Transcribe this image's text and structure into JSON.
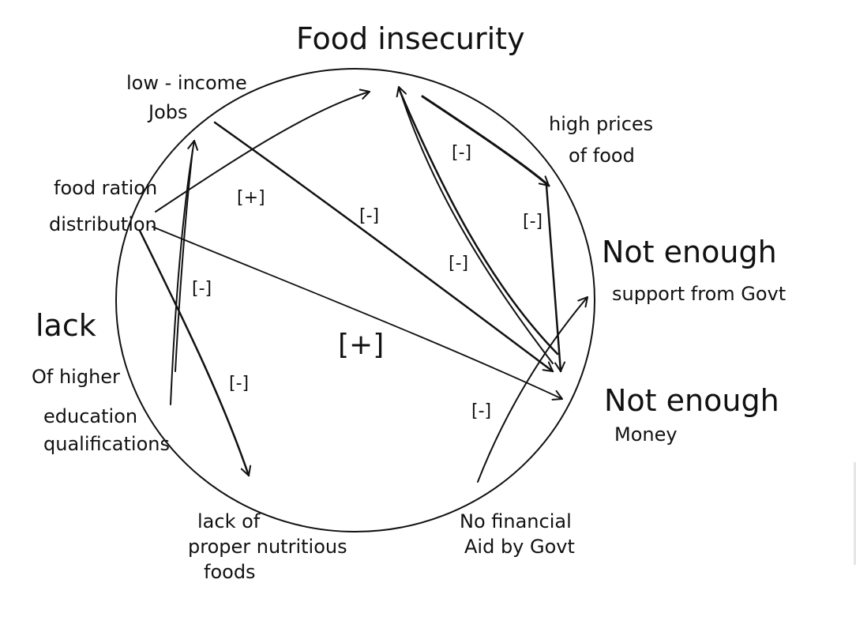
{
  "diagram": {
    "nodes": [
      {
        "id": "food_insecurity",
        "lines": [
          "Food insecurity"
        ]
      },
      {
        "id": "low_income_jobs",
        "lines": [
          "low - income",
          "Jobs"
        ]
      },
      {
        "id": "high_prices",
        "lines": [
          "high prices",
          "of food"
        ]
      },
      {
        "id": "food_ration",
        "lines": [
          "food ration",
          "distribution"
        ]
      },
      {
        "id": "not_enough_support",
        "lines": [
          "Not enough",
          "support from Govt"
        ]
      },
      {
        "id": "lack_education",
        "lines": [
          "lack",
          "Of higher",
          "education",
          "qualifications"
        ]
      },
      {
        "id": "not_enough_money",
        "lines": [
          "Not enough",
          "Money"
        ]
      },
      {
        "id": "lack_nutritious",
        "lines": [
          "lack of",
          "proper nutritious",
          "foods"
        ]
      },
      {
        "id": "no_financial_aid",
        "lines": [
          "No financial",
          "Aid by Govt"
        ]
      }
    ],
    "edges": [
      {
        "from": "food_ration",
        "to": "food_insecurity",
        "sign": "[+]"
      },
      {
        "from": "food_insecurity",
        "to": "high_prices",
        "sign": "[-]"
      },
      {
        "from": "high_prices",
        "to": "not_enough_money",
        "sign": "[-]"
      },
      {
        "from": "low_income_jobs",
        "to": "not_enough_money",
        "sign": "[-]"
      },
      {
        "from": "not_enough_money",
        "to": "food_insecurity",
        "sign": "[-]"
      },
      {
        "from": "lack_education",
        "to": "low_income_jobs",
        "sign": "[-]"
      },
      {
        "from": "food_ration",
        "to": "not_enough_money",
        "sign": "[+]"
      },
      {
        "from": "food_ration",
        "to": "lack_nutritious",
        "sign": "[-]"
      },
      {
        "from": "no_financial_aid",
        "to": "not_enough_support",
        "sign": "[-]"
      }
    ]
  }
}
